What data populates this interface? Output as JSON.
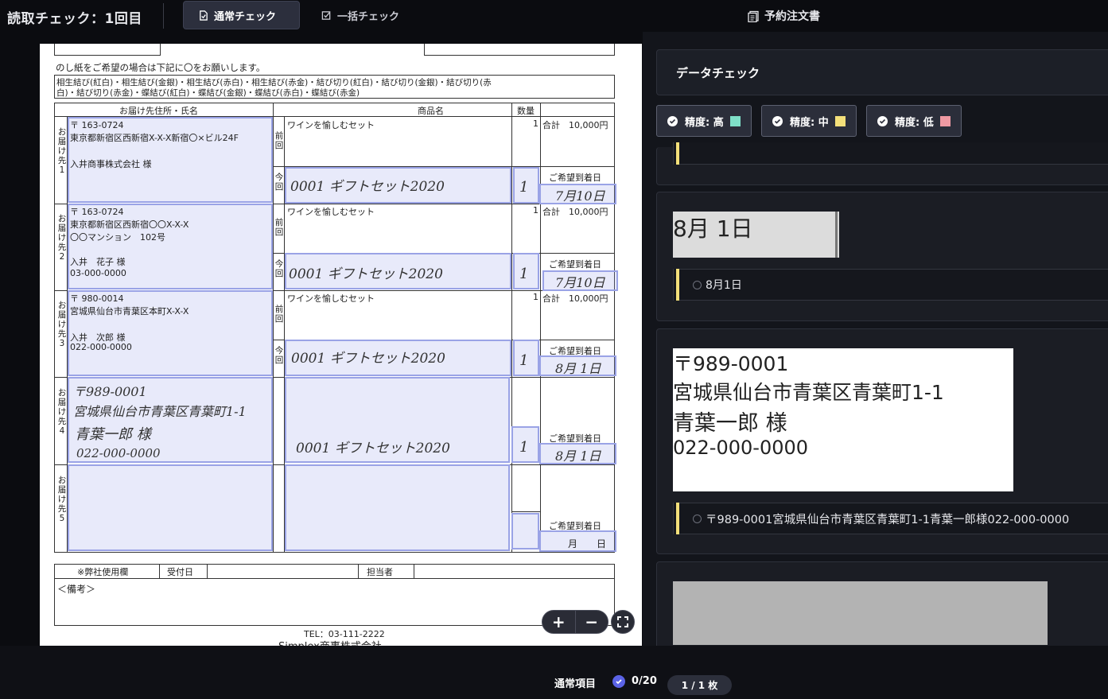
{
  "header": {
    "title": "読取チェック：1回目",
    "tab_normal": "通常チェック",
    "tab_bulk": "一括チェック",
    "document_name": "予約注文書"
  },
  "document": {
    "noshi_title": "のし紙をご希望の場合は下記に〇をお願いします。",
    "noshi_options_line1": "相生結び(紅白)・相生結び(金銀)・相生結び(赤白)・相生結び(赤金)・結び切り(紅白)・結び切り(金銀)・結び切り(赤",
    "noshi_options_line2": "白)・結び切り(赤金)・蝶結び(紅白)・蝶結び(金銀)・蝶結び(赤白)・蝶結び(赤金)",
    "col_address": "お届け先住所・氏名",
    "col_product": "商品名",
    "col_qty": "数量",
    "previous_label": "前回",
    "current_label": "今回",
    "desired_date_label": "ご希望到着日",
    "rows": [
      {
        "dest_label": "お届け先1",
        "postal": "〒 163-0724",
        "address": "東京都新宿区西新宿X-X-X新宿〇×ビル24F",
        "name": "入井商事株式会社 様",
        "phone": "",
        "prev_product": "ワインを愉しむセット",
        "prev_qty": "1",
        "prev_total": "合計　10,000円",
        "hw_product": "0001 ギフトセット2020",
        "hw_qty": "1",
        "hw_date": "7月10日"
      },
      {
        "dest_label": "お届け先2",
        "postal": "〒 163-0724",
        "address": "東京都新宿区西新宿〇〇X-X-X",
        "address2": "〇〇マンション　102号",
        "name": "入井　花子 様",
        "phone": "03-000-0000",
        "prev_product": "ワインを愉しむセット",
        "prev_qty": "1",
        "prev_total": "合計　10,000円",
        "hw_product": "0001 ギフトセット2020",
        "hw_qty": "1",
        "hw_date": "7月10日"
      },
      {
        "dest_label": "お届け先3",
        "postal": "〒 980-0014",
        "address": "宮城県仙台市青葉区本町X-X-X",
        "name": "入井　次郎 様",
        "phone": "022-000-0000",
        "prev_product": "ワインを愉しむセット",
        "prev_qty": "1",
        "prev_total": "合計　10,000円",
        "hw_product": "0001 ギフトセット2020",
        "hw_qty": "1",
        "hw_date": "8月 1日"
      },
      {
        "dest_label": "お届け先4",
        "hw_postal": "〒989-0001",
        "hw_address": "宮城県仙台市青葉区青葉町1-1",
        "hw_name": "青葉一郎 様",
        "hw_phone": "022-000-0000",
        "hw_product": "0001 ギフトセット2020",
        "hw_qty": "1",
        "hw_date": "8月 1日"
      },
      {
        "dest_label": "お届け先5",
        "hw_date": "月　　日"
      }
    ],
    "office_use": "※弊社使用欄",
    "received_date": "受付日",
    "person_in_charge": "担当者",
    "remarks": "＜備考＞",
    "tel": "TEL：03-111-2222",
    "company": "Simplex商事株式会社"
  },
  "viewer": {
    "zoom_in": "+",
    "zoom_out": "−"
  },
  "panel": {
    "title": "データチェック",
    "filters": [
      {
        "label": "精度: 高",
        "color": "#7fe0c8"
      },
      {
        "label": "精度: 中",
        "color": "#f4e07a"
      },
      {
        "label": "精度: 低",
        "color": "#ef9aa3"
      }
    ],
    "cards": [
      {
        "crop_text": "8月 1日",
        "answer": "8月1日"
      },
      {
        "crop_lines": [
          "〒989-0001",
          "宮城県仙台市青葉区青葉町1-1",
          "青葉一郎 様",
          "022-000-0000"
        ],
        "answer": "〒989-0001宮城県仙台市青葉区青葉町1-1青葉一郎様022-000-0000"
      }
    ]
  },
  "footer": {
    "label": "通常項目",
    "count": "0/20",
    "page": "1 / 1 枚"
  }
}
